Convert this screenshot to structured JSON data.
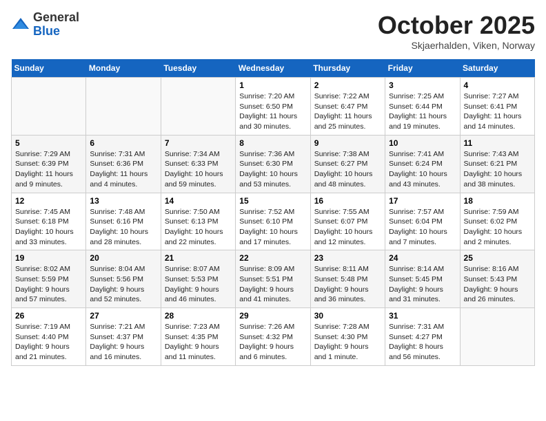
{
  "header": {
    "logo": {
      "line1": "General",
      "line2": "Blue"
    },
    "title": "October 2025",
    "location": "Skjaerhalden, Viken, Norway"
  },
  "days_of_week": [
    "Sunday",
    "Monday",
    "Tuesday",
    "Wednesday",
    "Thursday",
    "Friday",
    "Saturday"
  ],
  "weeks": [
    [
      {
        "day": "",
        "info": ""
      },
      {
        "day": "",
        "info": ""
      },
      {
        "day": "",
        "info": ""
      },
      {
        "day": "1",
        "info": "Sunrise: 7:20 AM\nSunset: 6:50 PM\nDaylight: 11 hours and 30 minutes."
      },
      {
        "day": "2",
        "info": "Sunrise: 7:22 AM\nSunset: 6:47 PM\nDaylight: 11 hours and 25 minutes."
      },
      {
        "day": "3",
        "info": "Sunrise: 7:25 AM\nSunset: 6:44 PM\nDaylight: 11 hours and 19 minutes."
      },
      {
        "day": "4",
        "info": "Sunrise: 7:27 AM\nSunset: 6:41 PM\nDaylight: 11 hours and 14 minutes."
      }
    ],
    [
      {
        "day": "5",
        "info": "Sunrise: 7:29 AM\nSunset: 6:39 PM\nDaylight: 11 hours and 9 minutes."
      },
      {
        "day": "6",
        "info": "Sunrise: 7:31 AM\nSunset: 6:36 PM\nDaylight: 11 hours and 4 minutes."
      },
      {
        "day": "7",
        "info": "Sunrise: 7:34 AM\nSunset: 6:33 PM\nDaylight: 10 hours and 59 minutes."
      },
      {
        "day": "8",
        "info": "Sunrise: 7:36 AM\nSunset: 6:30 PM\nDaylight: 10 hours and 53 minutes."
      },
      {
        "day": "9",
        "info": "Sunrise: 7:38 AM\nSunset: 6:27 PM\nDaylight: 10 hours and 48 minutes."
      },
      {
        "day": "10",
        "info": "Sunrise: 7:41 AM\nSunset: 6:24 PM\nDaylight: 10 hours and 43 minutes."
      },
      {
        "day": "11",
        "info": "Sunrise: 7:43 AM\nSunset: 6:21 PM\nDaylight: 10 hours and 38 minutes."
      }
    ],
    [
      {
        "day": "12",
        "info": "Sunrise: 7:45 AM\nSunset: 6:18 PM\nDaylight: 10 hours and 33 minutes."
      },
      {
        "day": "13",
        "info": "Sunrise: 7:48 AM\nSunset: 6:16 PM\nDaylight: 10 hours and 28 minutes."
      },
      {
        "day": "14",
        "info": "Sunrise: 7:50 AM\nSunset: 6:13 PM\nDaylight: 10 hours and 22 minutes."
      },
      {
        "day": "15",
        "info": "Sunrise: 7:52 AM\nSunset: 6:10 PM\nDaylight: 10 hours and 17 minutes."
      },
      {
        "day": "16",
        "info": "Sunrise: 7:55 AM\nSunset: 6:07 PM\nDaylight: 10 hours and 12 minutes."
      },
      {
        "day": "17",
        "info": "Sunrise: 7:57 AM\nSunset: 6:04 PM\nDaylight: 10 hours and 7 minutes."
      },
      {
        "day": "18",
        "info": "Sunrise: 7:59 AM\nSunset: 6:02 PM\nDaylight: 10 hours and 2 minutes."
      }
    ],
    [
      {
        "day": "19",
        "info": "Sunrise: 8:02 AM\nSunset: 5:59 PM\nDaylight: 9 hours and 57 minutes."
      },
      {
        "day": "20",
        "info": "Sunrise: 8:04 AM\nSunset: 5:56 PM\nDaylight: 9 hours and 52 minutes."
      },
      {
        "day": "21",
        "info": "Sunrise: 8:07 AM\nSunset: 5:53 PM\nDaylight: 9 hours and 46 minutes."
      },
      {
        "day": "22",
        "info": "Sunrise: 8:09 AM\nSunset: 5:51 PM\nDaylight: 9 hours and 41 minutes."
      },
      {
        "day": "23",
        "info": "Sunrise: 8:11 AM\nSunset: 5:48 PM\nDaylight: 9 hours and 36 minutes."
      },
      {
        "day": "24",
        "info": "Sunrise: 8:14 AM\nSunset: 5:45 PM\nDaylight: 9 hours and 31 minutes."
      },
      {
        "day": "25",
        "info": "Sunrise: 8:16 AM\nSunset: 5:43 PM\nDaylight: 9 hours and 26 minutes."
      }
    ],
    [
      {
        "day": "26",
        "info": "Sunrise: 7:19 AM\nSunset: 4:40 PM\nDaylight: 9 hours and 21 minutes."
      },
      {
        "day": "27",
        "info": "Sunrise: 7:21 AM\nSunset: 4:37 PM\nDaylight: 9 hours and 16 minutes."
      },
      {
        "day": "28",
        "info": "Sunrise: 7:23 AM\nSunset: 4:35 PM\nDaylight: 9 hours and 11 minutes."
      },
      {
        "day": "29",
        "info": "Sunrise: 7:26 AM\nSunset: 4:32 PM\nDaylight: 9 hours and 6 minutes."
      },
      {
        "day": "30",
        "info": "Sunrise: 7:28 AM\nSunset: 4:30 PM\nDaylight: 9 hours and 1 minute."
      },
      {
        "day": "31",
        "info": "Sunrise: 7:31 AM\nSunset: 4:27 PM\nDaylight: 8 hours and 56 minutes."
      },
      {
        "day": "",
        "info": ""
      }
    ]
  ]
}
